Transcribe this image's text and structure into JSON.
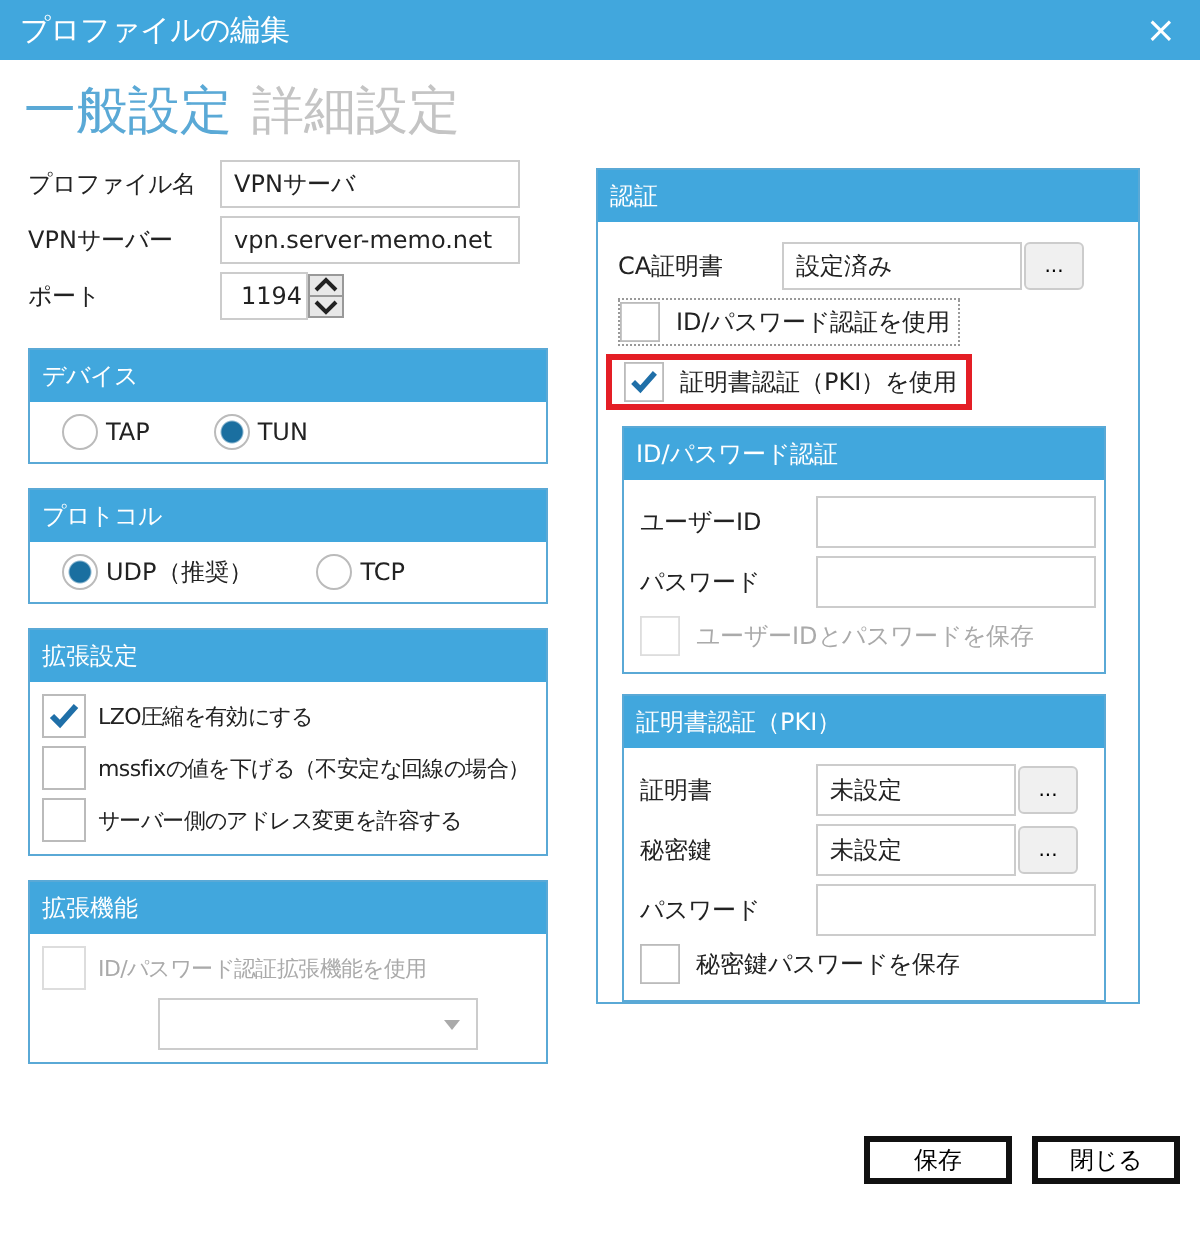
{
  "window": {
    "title": "プロファイルの編集",
    "close": "×"
  },
  "tabs": [
    {
      "label": "一般設定",
      "selected": true
    },
    {
      "label": "詳細設定",
      "selected": false
    }
  ],
  "fields": [
    {
      "label": "プロファイル名",
      "value": "VPNサーバ",
      "kind": "text"
    },
    {
      "label": "VPNサーバー",
      "value": "vpn.server-memo.net",
      "kind": "text"
    },
    {
      "label": "ポート",
      "value": "1194",
      "kind": "spin"
    }
  ],
  "groups": [
    {
      "title": "デバイス",
      "items": [
        {
          "kind": "radio",
          "label": "TAP",
          "selected": false
        },
        {
          "kind": "radio",
          "label": "TUN",
          "selected": true
        }
      ]
    },
    {
      "title": "プロトコル",
      "items": [
        {
          "kind": "radio",
          "label": "UDP（推奨）",
          "selected": true
        },
        {
          "kind": "radio",
          "label": "TCP",
          "selected": false
        }
      ]
    },
    {
      "title": "拡張設定",
      "items": [
        {
          "kind": "checkbox",
          "label": "LZO圧縮を有効にする",
          "checked": true,
          "disabled": false
        },
        {
          "kind": "checkbox",
          "label": "mssfixの値を下げる（不安定な回線の場合）",
          "checked": false,
          "disabled": false
        },
        {
          "kind": "checkbox",
          "label": "サーバー側のアドレス変更を許容する",
          "checked": false,
          "disabled": false
        }
      ]
    },
    {
      "title": "拡張機能",
      "items": [
        {
          "kind": "checkbox",
          "label": "ID/パスワード認証拡張機能を使用",
          "checked": false,
          "disabled": true
        },
        {
          "kind": "dropdown"
        }
      ]
    }
  ],
  "auth": {
    "title": "認証",
    "ca": {
      "label": "CA証明書",
      "value": "設定済み",
      "button": "..."
    },
    "options": [
      {
        "label": "ID/パスワード認証を使用",
        "checked": false,
        "focused": true,
        "highlighted": false
      },
      {
        "label": "証明書認証（PKI）を使用",
        "checked": true,
        "focused": false,
        "highlighted": true
      }
    ],
    "subgroups": [
      {
        "title": "ID/パスワード認証",
        "items": [
          {
            "kind": "input",
            "label": "ユーザーID"
          },
          {
            "kind": "input",
            "label": "パスワード"
          },
          {
            "kind": "checkbox",
            "label": "ユーザーIDとパスワードを保存",
            "checked": false,
            "disabled": true
          }
        ]
      },
      {
        "title": "証明書認証（PKI）",
        "items": [
          {
            "kind": "file",
            "label": "証明書",
            "value": "未設定",
            "button": "..."
          },
          {
            "kind": "file",
            "label": "秘密鍵",
            "value": "未設定",
            "button": "..."
          },
          {
            "kind": "input",
            "label": "パスワード"
          },
          {
            "kind": "checkbox",
            "label": "秘密鍵パスワードを保存",
            "checked": false,
            "disabled": false
          }
        ]
      }
    ]
  },
  "buttons": [
    "保存",
    "閉じる"
  ]
}
